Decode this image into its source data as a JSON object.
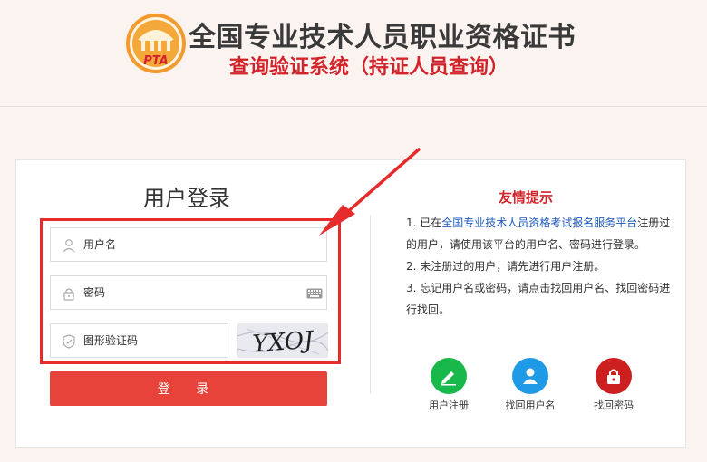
{
  "header": {
    "logo_text": "PTA",
    "title": "全国专业技术人员职业资格证书",
    "subtitle": "查询验证系统（持证人员查询）"
  },
  "login": {
    "title": "用户登录",
    "username_placeholder": "用户名",
    "password_placeholder": "密码",
    "captcha_placeholder": "图形验证码",
    "captcha_text": "YXOJ",
    "submit_label": "登 录"
  },
  "tips": {
    "title": "友情提示",
    "line1_prefix": "1. 已在",
    "line1_link": "全国专业技术人员资格考试报名服务平台",
    "line1_suffix": "注册过的用户，请使用该平台的用户名、密码进行登录。",
    "line2": "2. 未注册过的用户，请先进行用户注册。",
    "line3": "3. 忘记用户名或密码，请点击找回用户名、找回密码进行找回。"
  },
  "actions": [
    {
      "label": "用户注册",
      "icon": "pencil-icon",
      "color": "#19b84a"
    },
    {
      "label": "找回用户名",
      "icon": "user-icon",
      "color": "#1f9ae6"
    },
    {
      "label": "找回密码",
      "icon": "lock-icon",
      "color": "#cc1f1f"
    }
  ],
  "colors": {
    "accent_red": "#d2232a",
    "button_red": "#e8433a",
    "link_blue": "#1e5bbf"
  }
}
